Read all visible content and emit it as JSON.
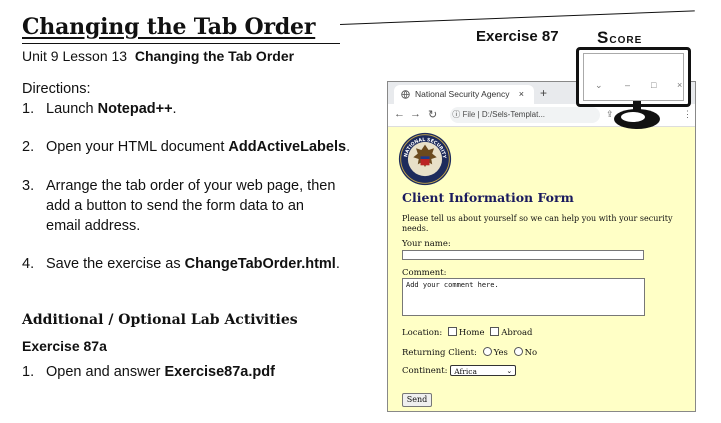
{
  "header": {
    "title": "Changing the Tab Order",
    "exercise_number": "Exercise 87",
    "score_label": "Score",
    "unit_prefix": "Unit 9 Lesson 13",
    "unit_title": "Changing the Tab Order"
  },
  "directions": {
    "heading": "Directions:",
    "steps": [
      {
        "n": "1.",
        "pre": "Launch ",
        "bold": "Notepad++",
        "post": "."
      },
      {
        "n": "2.",
        "pre": "Open your HTML document ",
        "bold": "AddActiveLabels",
        "post": "."
      },
      {
        "n": "3.",
        "line1": "Arrange the tab order of your web page, then",
        "line2": "add a button to send the form data to an",
        "line3": "email address."
      },
      {
        "n": "4.",
        "pre": "Save the exercise as ",
        "bold": "ChangeTabOrder.html",
        "post": "."
      }
    ]
  },
  "additional": {
    "heading": "Additional / Optional Lab Activities",
    "exercise": "Exercise 87a",
    "item_n": "1.",
    "item_pre": "Open and answer ",
    "item_bold": "Exercise87a.pdf"
  },
  "browser": {
    "tab_title": "National Security Agency",
    "tab_close": "×",
    "new_tab": "+",
    "url_prefix": "File",
    "url": "D:/Sels-Templat...",
    "window_controls": [
      "⌄",
      "–",
      "□",
      "×"
    ]
  },
  "form": {
    "seal_text": "NATIONAL SECURITY AGENCY",
    "title": "Client Information Form",
    "description": "Please tell us about yourself so we can help you with your security needs.",
    "name_label": "Your name:",
    "comment_label": "Comment:",
    "comment_placeholder": "Add your comment here.",
    "location_label": "Location:",
    "location_options": [
      "Home",
      "Abroad"
    ],
    "returning_label": "Returning Client:",
    "returning_options": [
      "Yes",
      "No"
    ],
    "continent_label": "Continent:",
    "continent_value": "Africa",
    "send_label": "Send"
  },
  "colors": {
    "page_background": "#ffffc6",
    "form_title": "#1a1a5e"
  }
}
